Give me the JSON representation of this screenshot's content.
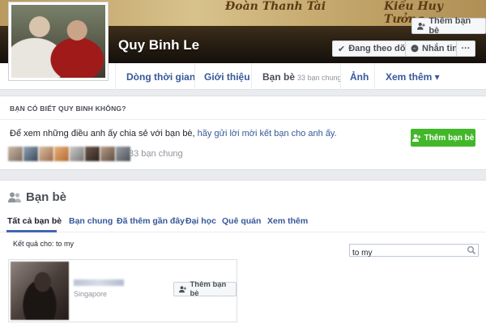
{
  "cover": {
    "names": [
      "Đoàn Thanh Tài",
      "Kiều Huy Tưởng"
    ]
  },
  "profile": {
    "name": "Quy Binh Le"
  },
  "header_buttons": {
    "add_friend": "Thêm bạn bè",
    "following": "Đang theo dõi",
    "message": "Nhắn tin",
    "more": "···"
  },
  "nav": {
    "timeline": "Dòng thời gian",
    "about": "Giới thiệu",
    "friends": "Bạn bè",
    "friends_mutual": "33 bạn chung",
    "photos": "Ảnh",
    "more": "Xem thêm ▾"
  },
  "suggest": {
    "title": "BẠN CÓ BIẾT QUY BINH KHÔNG?",
    "body_plain": "Để xem những điều anh ấy chia sẻ với bạn bè,",
    "body_link": "hãy gửi lời mời kết bạn cho anh ấy.",
    "button": "Thêm bạn bè",
    "mutual_count": "33 bạn chung"
  },
  "friends": {
    "title": "Bạn bè",
    "tabs": [
      "Tất cả bạn bè",
      "Bạn chung",
      "Đã thêm gần đây",
      "Đại học",
      "Quê quán",
      "Xem thêm"
    ],
    "search_value": "to my",
    "results_label": "Kết quả cho: to my",
    "card": {
      "location": "Singapore",
      "button": "Thêm bạn bè"
    }
  },
  "icons": {
    "add_friend": "person-plus-icon",
    "messenger": "messenger-icon",
    "friends_header": "two-people-icon",
    "search": "magnifier-icon"
  },
  "colors": {
    "link": "#365899",
    "green_button": "#42b72a",
    "tab_underline": "#4267b2"
  }
}
